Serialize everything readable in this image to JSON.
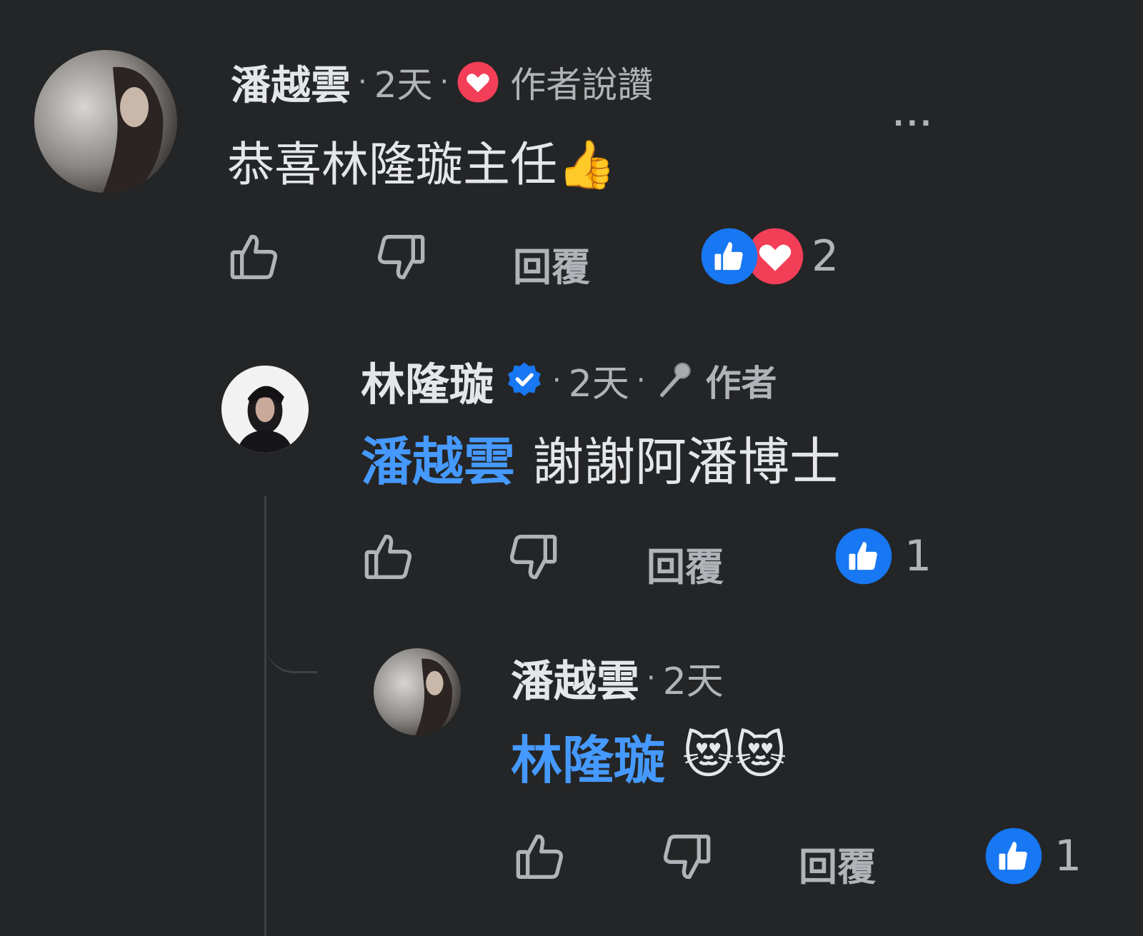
{
  "comments": [
    {
      "author": "潘越雲",
      "time": "2天",
      "badge": "作者說讚",
      "text": "恭喜林隆璇主任👍",
      "reply_label": "回覆",
      "reaction_count": "2",
      "more": "···"
    },
    {
      "author": "林隆璇",
      "time": "2天",
      "badge": "作者",
      "mention": "潘越雲",
      "text": "謝謝阿潘博士",
      "reply_label": "回覆",
      "reaction_count": "1"
    },
    {
      "author": "潘越雲",
      "time": "2天",
      "mention": "林隆璇",
      "text": "😻😻",
      "reply_label": "回覆",
      "reaction_count": "1"
    }
  ],
  "icons": {
    "like": "thumbs-up-outline-icon",
    "dislike": "thumbs-down-outline-icon",
    "reaction_like": "like-reaction-icon",
    "reaction_love": "love-reaction-icon",
    "verified": "verified-badge-icon",
    "author": "microphone-icon"
  },
  "colors": {
    "background": "#242526",
    "text": "#e4e6eb",
    "secondary": "#b0b3b8",
    "mention": "#4599ff",
    "like_blue": "#1877f2",
    "love_red": "#f33e58"
  }
}
